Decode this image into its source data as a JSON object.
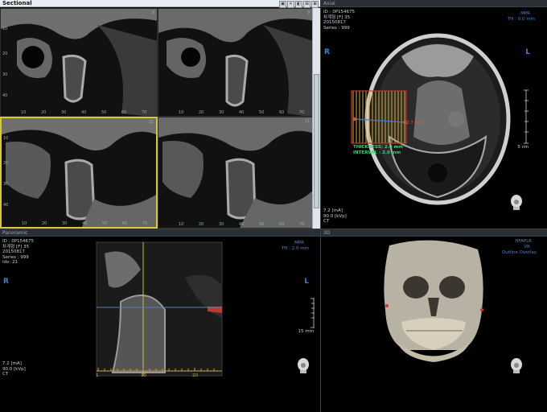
{
  "sectional": {
    "title": "Sectional",
    "window_icons": [
      "▣",
      "✕",
      "◧",
      "⊟",
      "⊞"
    ],
    "tiles": [
      {
        "num": "9",
        "y_ticks": [
          "10",
          "20",
          "30",
          "40"
        ],
        "x_ticks": [
          "10",
          "20",
          "30",
          "40",
          "50",
          "60",
          "70"
        ]
      },
      {
        "num": "9",
        "y_ticks": [],
        "x_ticks": [
          "10",
          "20",
          "30",
          "40",
          "50",
          "60",
          "70"
        ]
      },
      {
        "num": "10",
        "y_ticks": [
          "10",
          "20",
          "30",
          "40"
        ],
        "x_ticks": [
          "10",
          "20",
          "30",
          "40",
          "50",
          "60",
          "70"
        ]
      },
      {
        "num": "11",
        "y_ticks": [],
        "x_ticks": [
          "10",
          "20",
          "30",
          "40",
          "50",
          "60",
          "70"
        ]
      }
    ]
  },
  "axial": {
    "title": "Axial",
    "info": "ID : 0P154675\n차계형 [F] 35\n20150817\nSeries : 999",
    "mode": "MPR",
    "thickness": "TH : 0.0 mm",
    "side_left": "R",
    "side_right": "L",
    "scale": "5 cm",
    "acq": "7.2 [mA]\n90.0 [kVp]\nCT",
    "annotation": "THICKNESS: 2.0 mm\nINTERVAL : 2.0 mm",
    "measure": "2.7 mm"
  },
  "panoramic": {
    "title": "Panoramic",
    "info": "ID : 0P154675\n차계형 [F] 35\n20150817\nSeries : 999\nIdx: 21",
    "mode": "MPR",
    "thickness": "TH : 2.0 mm",
    "side_left": "R",
    "side_right": "L",
    "scale": "15 mm",
    "acq": "7.2 [mA]\n90.0 [kVp]\nCT",
    "x_ticks": [
      "1",
      "10",
      "20"
    ]
  },
  "threed": {
    "title": "3D",
    "mode": "HFAPLR",
    "sub": "VR",
    "overlay": "Outline Overlay"
  },
  "colors": {
    "accent_yellow": "#d9c83a",
    "orientation_blue": "#4c7cc9",
    "header": "#2a2f36"
  }
}
